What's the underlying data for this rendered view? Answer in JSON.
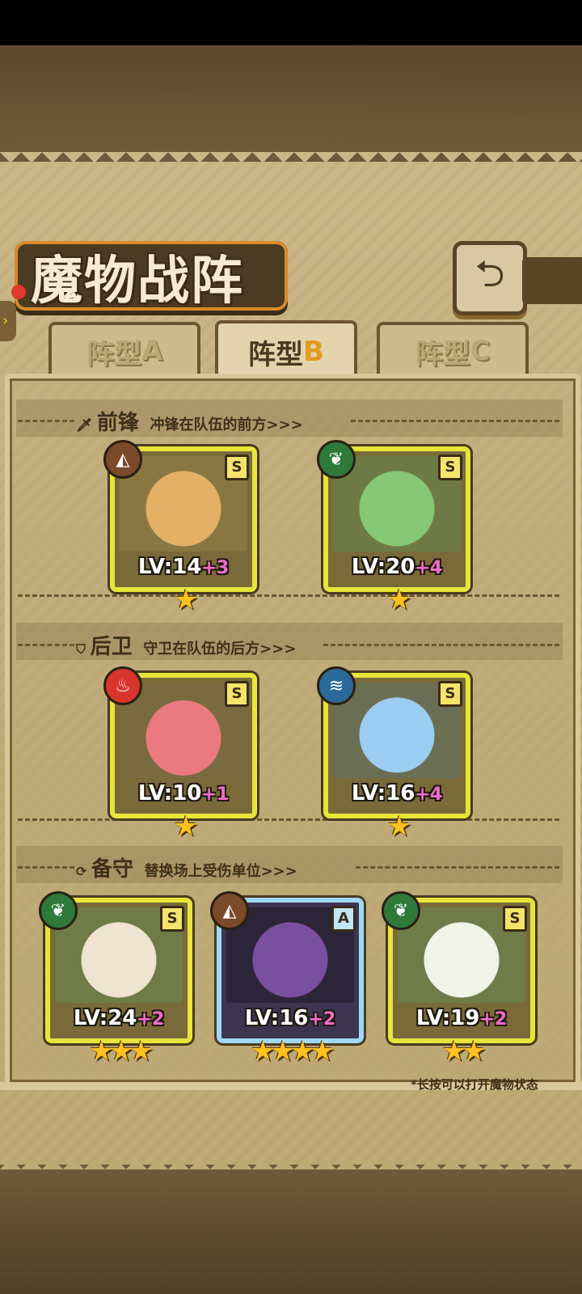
{
  "header": {
    "title": "魔物战阵"
  },
  "tabs": [
    {
      "label_main": "阵型",
      "label_letter": "A"
    },
    {
      "label_main": "阵型",
      "label_letter": "B"
    },
    {
      "label_main": "阵型",
      "label_letter": "C"
    }
  ],
  "sections": {
    "front": {
      "title": "前锋",
      "subtitle": "冲锋在队伍的前方>>>"
    },
    "back": {
      "title": "后卫",
      "subtitle": "守卫在队伍的后方>>>"
    },
    "reserve": {
      "title": "备守",
      "subtitle": "替换场上受伤单位>>>"
    }
  },
  "cards": {
    "c1": {
      "rank": "S",
      "lv": "LV:14",
      "bonus": "+3",
      "stars": "★",
      "element": "earth-icon",
      "art_color": "#d9a456"
    },
    "c2": {
      "rank": "S",
      "lv": "LV:20",
      "bonus": "+4",
      "stars": "★",
      "element": "leaf-icon",
      "art_color": "#7fbf6a"
    },
    "c3": {
      "rank": "S",
      "lv": "LV:10",
      "bonus": "+1",
      "stars": "★",
      "element": "fire-icon",
      "art_color": "#e4747a"
    },
    "c4": {
      "rank": "S",
      "lv": "LV:16",
      "bonus": "+4",
      "stars": "★",
      "element": "water-icon",
      "art_color": "#8cc3ec"
    },
    "c5": {
      "rank": "S",
      "lv": "LV:24",
      "bonus": "+2",
      "stars": "★★★",
      "element": "leaf-icon",
      "art_color": "#e9dcc4"
    },
    "c6": {
      "rank": "A",
      "lv": "LV:16",
      "bonus": "+2",
      "stars": "★★★★",
      "element": "earth-icon",
      "art_color": "#5b3e7a"
    },
    "c7": {
      "rank": "S",
      "lv": "LV:19",
      "bonus": "+2",
      "stars": "★★",
      "element": "leaf-icon",
      "art_color": "#e8eede"
    }
  },
  "footnote": "*长按可以打开魔物状态",
  "colors": {
    "fire": "#d8342c",
    "leaf": "#2f7a3a",
    "earth": "#7a4a2a",
    "water": "#2a6a9a"
  }
}
